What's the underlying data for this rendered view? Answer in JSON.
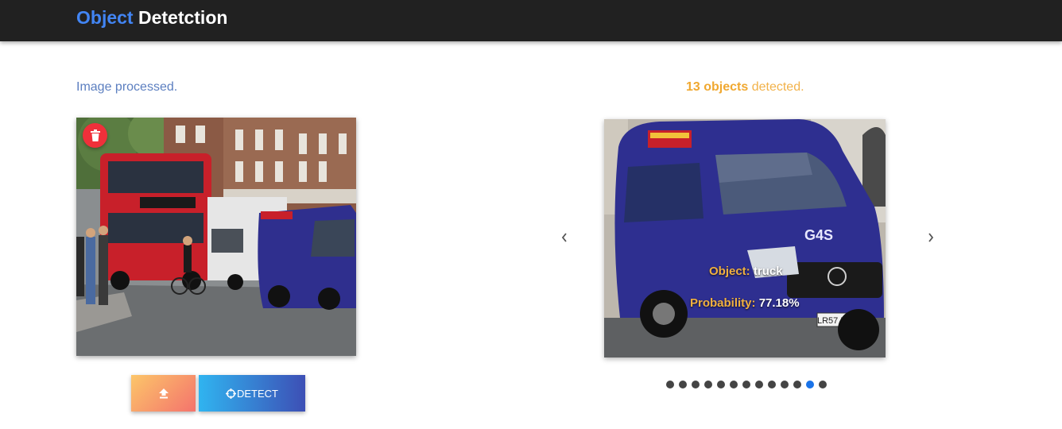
{
  "app": {
    "brand_part1": "Object",
    "brand_part2": "Detetction"
  },
  "status": {
    "left_message": "Image processed.",
    "right_count": "13 objects",
    "right_suffix": " detected."
  },
  "input_panel": {
    "delete_icon": "trash-icon",
    "upload_icon": "upload-icon",
    "detect_icon": "crosshair-icon",
    "detect_label": "DETECT"
  },
  "detection": {
    "object_label": "Object:",
    "object_value": "truck",
    "probability_label": "Probability:",
    "probability_value": "77.18%"
  },
  "carousel": {
    "prev_icon": "chevron-left-icon",
    "next_icon": "chevron-right-icon",
    "total_slides": 13,
    "active_index": 11
  },
  "colors": {
    "navbar": "#212121",
    "brand_accent": "#4285f4",
    "status_left": "#5c7fc0",
    "status_right": "#f2b24a",
    "delete": "#f0303a",
    "active_dot": "#1a73e8"
  }
}
